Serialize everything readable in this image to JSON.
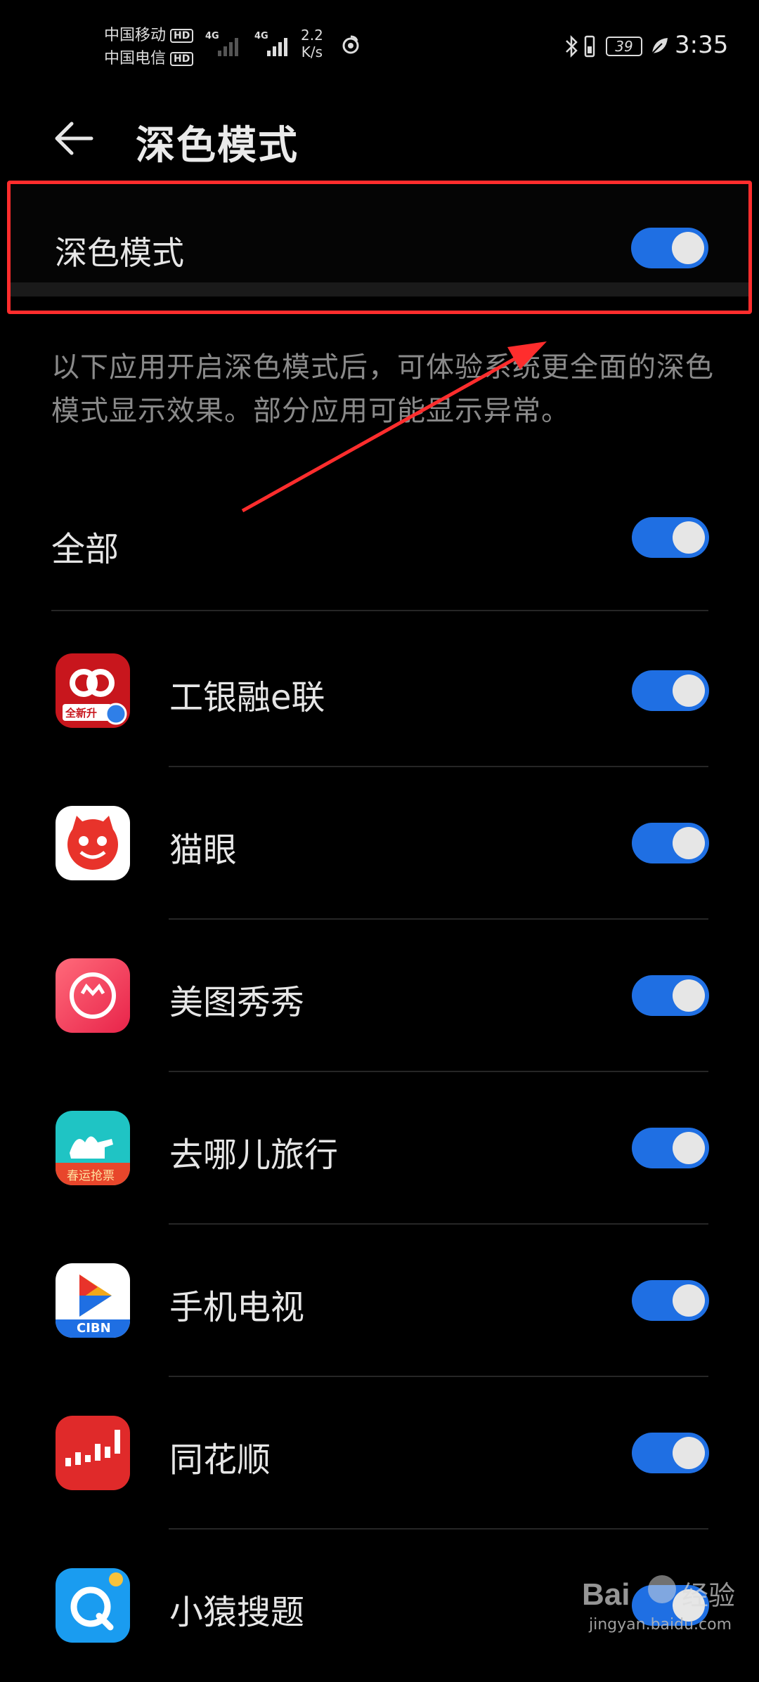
{
  "status_bar": {
    "carrier1": "中国移动",
    "carrier2": "中国电信",
    "hd": "HD",
    "network": "4G",
    "net_speed_value": "2.2",
    "net_speed_unit": "K/s",
    "battery_level": "39",
    "time": "3:35"
  },
  "header": {
    "back_icon": "arrow-left-icon",
    "title": "深色模式"
  },
  "master": {
    "label": "深色模式",
    "enabled": true
  },
  "description": "以下应用开启深色模式后，可体验系统更全面的深色模式显示效果。部分应用可能显示异常。",
  "all": {
    "label": "全部",
    "enabled": true
  },
  "apps": [
    {
      "name": "工银融e联",
      "icon": "icbc-elian-icon",
      "enabled": true
    },
    {
      "name": "猫眼",
      "icon": "maoyan-cat-icon",
      "enabled": true
    },
    {
      "name": "美图秀秀",
      "icon": "meitu-icon",
      "enabled": true
    },
    {
      "name": "去哪儿旅行",
      "icon": "qunar-camel-icon",
      "enabled": true
    },
    {
      "name": "手机电视",
      "icon": "cibn-tv-icon",
      "enabled": true
    },
    {
      "name": "同花顺",
      "icon": "tonghuashun-icon",
      "enabled": true
    },
    {
      "name": "小猿搜题",
      "icon": "xiaoyuan-icon",
      "enabled": true
    }
  ],
  "app_icon_labels": {
    "icbc_badge": "全新升",
    "qunar_badge": "春运抢票",
    "cibn_badge": "CIBN"
  },
  "watermark": {
    "brand": "Baidu经验",
    "url": "jingyan.baidu.com"
  },
  "colors": {
    "background": "#000000",
    "toggle_on": "#1f6fe3",
    "highlight_border": "#ff2d2d"
  }
}
